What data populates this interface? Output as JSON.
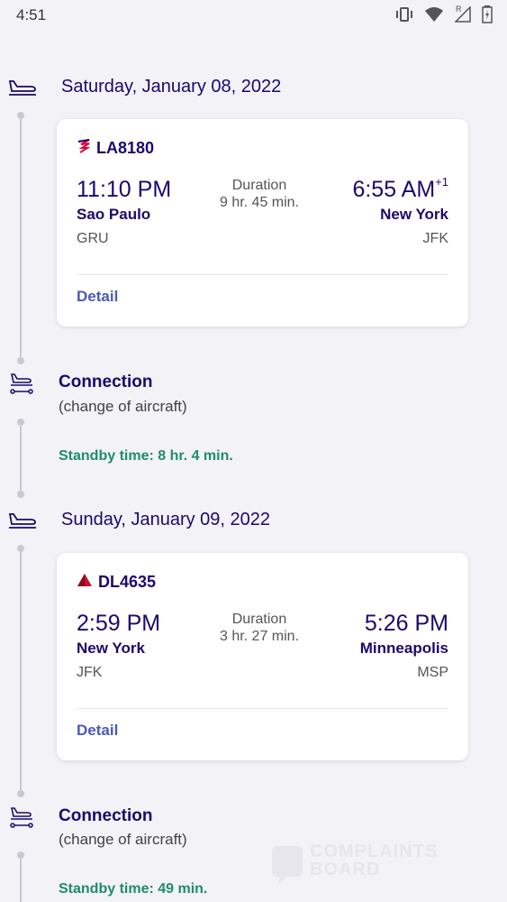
{
  "status_bar": {
    "time": "4:51",
    "network_indicator": "R"
  },
  "segments": [
    {
      "date": "Saturday, January 08, 2022",
      "flight_number": "LA8180",
      "airline_icon": "latam-logo-icon",
      "departure": {
        "time": "11:10 PM",
        "city": "Sao Paulo",
        "code": "GRU"
      },
      "duration_label": "Duration",
      "duration_value": "9 hr. 45 min.",
      "arrival": {
        "time": "6:55 AM",
        "day_offset": "+1",
        "city": "New York",
        "code": "JFK"
      },
      "detail_label": "Detail"
    },
    {
      "date": "Sunday, January 09, 2022",
      "flight_number": "DL4635",
      "airline_icon": "delta-logo-icon",
      "departure": {
        "time": "2:59 PM",
        "city": "New York",
        "code": "JFK"
      },
      "duration_label": "Duration",
      "duration_value": "3 hr. 27 min.",
      "arrival": {
        "time": "5:26 PM",
        "day_offset": "",
        "city": "Minneapolis",
        "code": "MSP"
      },
      "detail_label": "Detail"
    }
  ],
  "connections": [
    {
      "title": "Connection",
      "subtitle": "(change of aircraft)",
      "standby": "Standby time: 8 hr. 4 min."
    },
    {
      "title": "Connection",
      "subtitle": "(change of aircraft)",
      "standby": "Standby time: 49 min."
    }
  ],
  "watermark": {
    "line1": "COMPLAINTS",
    "line2": "BOARD"
  },
  "colors": {
    "primary": "#1b0a6b",
    "link": "#4a5ab8",
    "standby": "#1f8c6e",
    "latam": "#e4003a",
    "delta": "#c8102e"
  }
}
